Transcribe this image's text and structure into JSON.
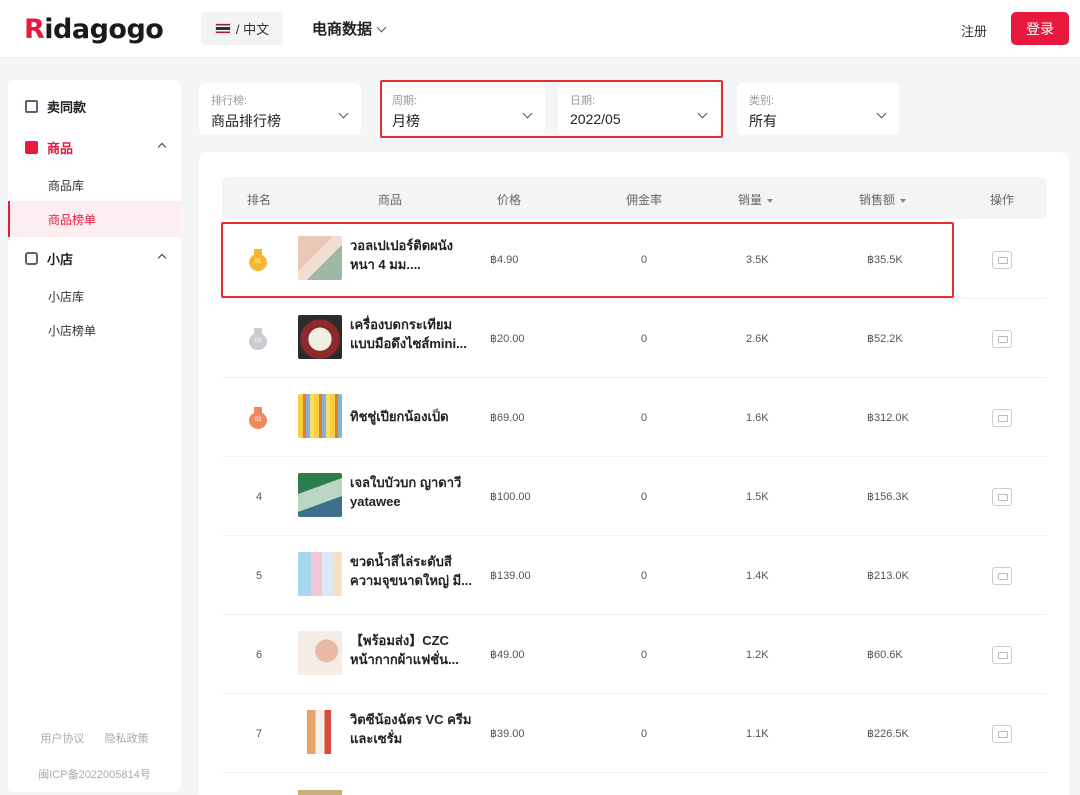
{
  "header": {
    "logo": "Ridagogo",
    "lang": "/ 中文",
    "nav_title": "电商数据",
    "register": "注册",
    "login": "登录"
  },
  "sidebar": {
    "groups": [
      {
        "label": "卖同款",
        "icon": "shop-icon"
      },
      {
        "label": "商品",
        "icon": "product-icon"
      },
      {
        "label": "小店",
        "icon": "store-icon"
      }
    ],
    "items": [
      "商品库",
      "商品榜单",
      "小店库",
      "小店榜单"
    ],
    "footer_links": [
      "用户协议",
      "隐私政策"
    ],
    "icp": "闽ICP备2022005814号"
  },
  "filters": [
    {
      "label": "排行榜:",
      "value": "商品排行榜"
    },
    {
      "label": "周期:",
      "value": "月榜"
    },
    {
      "label": "日期:",
      "value": "2022/05"
    },
    {
      "label": "类别:",
      "value": "所有"
    }
  ],
  "table": {
    "headers": [
      "排名",
      "商品",
      "价格",
      "佣金率",
      "销量",
      "销售额",
      "操作"
    ],
    "rows": [
      {
        "rank": "01",
        "name": "วอลเปเปอร์ติดผนัง หนา 4 มม....",
        "price": "฿4.90",
        "commission": "0",
        "sales": "3.5K",
        "revenue": "฿35.5K"
      },
      {
        "rank": "02",
        "name": "เครื่องบดกระเทียม แบบมือดึงไซส์mini...",
        "price": "฿20.00",
        "commission": "0",
        "sales": "2.6K",
        "revenue": "฿52.2K"
      },
      {
        "rank": "03",
        "name": "ทิชชู่เปียกน้องเป็ด",
        "price": "฿69.00",
        "commission": "0",
        "sales": "1.6K",
        "revenue": "฿312.0K"
      },
      {
        "rank": "4",
        "name": "เจลใบบัวบก ญาดาวี yatawee",
        "price": "฿100.00",
        "commission": "0",
        "sales": "1.5K",
        "revenue": "฿156.3K"
      },
      {
        "rank": "5",
        "name": "ขวดน้ำสีไล่ระดับสี ความจุขนาดใหญ่ มี...",
        "price": "฿139.00",
        "commission": "0",
        "sales": "1.4K",
        "revenue": "฿213.0K"
      },
      {
        "rank": "6",
        "name": "【พร้อมส่ง】CZC หน้ากากผ้าแฟชั่น...",
        "price": "฿49.00",
        "commission": "0",
        "sales": "1.2K",
        "revenue": "฿60.6K"
      },
      {
        "rank": "7",
        "name": "วิตซีน้องฉัตร VC ครีม และเซรั่ม",
        "price": "฿39.00",
        "commission": "0",
        "sales": "1.1K",
        "revenue": "฿226.5K"
      }
    ]
  },
  "colors": {
    "accent": "#e8193c",
    "highlight": "#e52e2e",
    "gold": "#f5b82e",
    "silver": "#c9cdd3",
    "bronze": "#f08a5d"
  }
}
